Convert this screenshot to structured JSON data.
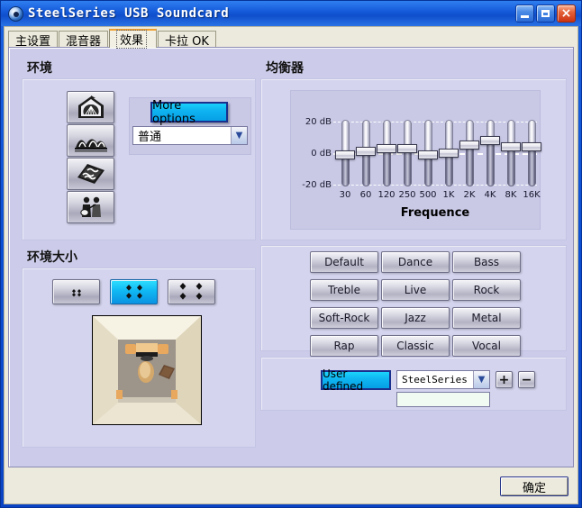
{
  "window": {
    "title": "SteelSeries USB Soundcard",
    "logo_icon": "soundcard-logo-icon",
    "minimize_label": "",
    "maximize_label": "",
    "close_label": "×"
  },
  "tabs": [
    {
      "label": "主设置",
      "name": "tab-main-settings",
      "active": false
    },
    {
      "label": "混音器",
      "name": "tab-mixer",
      "active": false
    },
    {
      "label": "效果",
      "name": "tab-effects",
      "active": true
    },
    {
      "label": "卡拉 OK",
      "name": "tab-karaoke",
      "active": false
    }
  ],
  "environment": {
    "title": "环境",
    "icon_buttons": [
      {
        "name": "env-icon-hall",
        "icon": "concert-hall-icon"
      },
      {
        "name": "env-icon-opera",
        "icon": "opera-house-icon"
      },
      {
        "name": "env-icon-stone",
        "icon": "stone-plate-icon"
      },
      {
        "name": "env-icon-band",
        "icon": "live-band-icon"
      }
    ],
    "more_options_label": "More options",
    "preset_value": "普通"
  },
  "environment_size": {
    "title": "环境大小",
    "buttons": [
      {
        "name": "env-size-small",
        "icon": "speakers-small-icon",
        "selected": false
      },
      {
        "name": "env-size-medium",
        "icon": "speakers-medium-icon",
        "selected": true
      },
      {
        "name": "env-size-large",
        "icon": "speakers-large-icon",
        "selected": false
      }
    ],
    "preview_name": "room-preview-image"
  },
  "equalizer": {
    "title": "均衡器",
    "presets": [
      {
        "label": "Default",
        "name": "preset-default"
      },
      {
        "label": "Dance",
        "name": "preset-dance"
      },
      {
        "label": "Bass",
        "name": "preset-bass"
      },
      {
        "label": "Treble",
        "name": "preset-treble"
      },
      {
        "label": "Live",
        "name": "preset-live"
      },
      {
        "label": "Rock",
        "name": "preset-rock"
      },
      {
        "label": "Soft-Rock",
        "name": "preset-soft-rock"
      },
      {
        "label": "Jazz",
        "name": "preset-jazz"
      },
      {
        "label": "Metal",
        "name": "preset-metal"
      },
      {
        "label": "Rap",
        "name": "preset-rap"
      },
      {
        "label": "Classic",
        "name": "preset-classic"
      },
      {
        "label": "Vocal",
        "name": "preset-vocal"
      }
    ],
    "user_defined_label": "User defined",
    "profile_value": "SteelSeries US",
    "add_label": "+",
    "remove_label": "−",
    "name_input_value": "",
    "name_input_placeholder": ""
  },
  "chart_data": {
    "type": "bar",
    "title": "均衡器",
    "xlabel": "Frequence",
    "ylabel": "dB",
    "categories": [
      "30",
      "60",
      "120",
      "250",
      "500",
      "1K",
      "2K",
      "4K",
      "8K",
      "16K"
    ],
    "values": [
      -1,
      1,
      3,
      3,
      -1,
      0,
      5,
      8,
      4,
      4
    ],
    "ylim": [
      -20,
      20
    ],
    "ytick_labels": [
      "20 dB",
      "0  dB",
      "-20 dB"
    ],
    "ytick_values": [
      20,
      0,
      -20
    ],
    "grid": true,
    "legend": "none",
    "series": [
      {
        "name": "User defined",
        "values": [
          -1,
          1,
          3,
          3,
          -1,
          0,
          5,
          8,
          4,
          4
        ]
      }
    ]
  },
  "footer": {
    "ok_label": "确定"
  }
}
